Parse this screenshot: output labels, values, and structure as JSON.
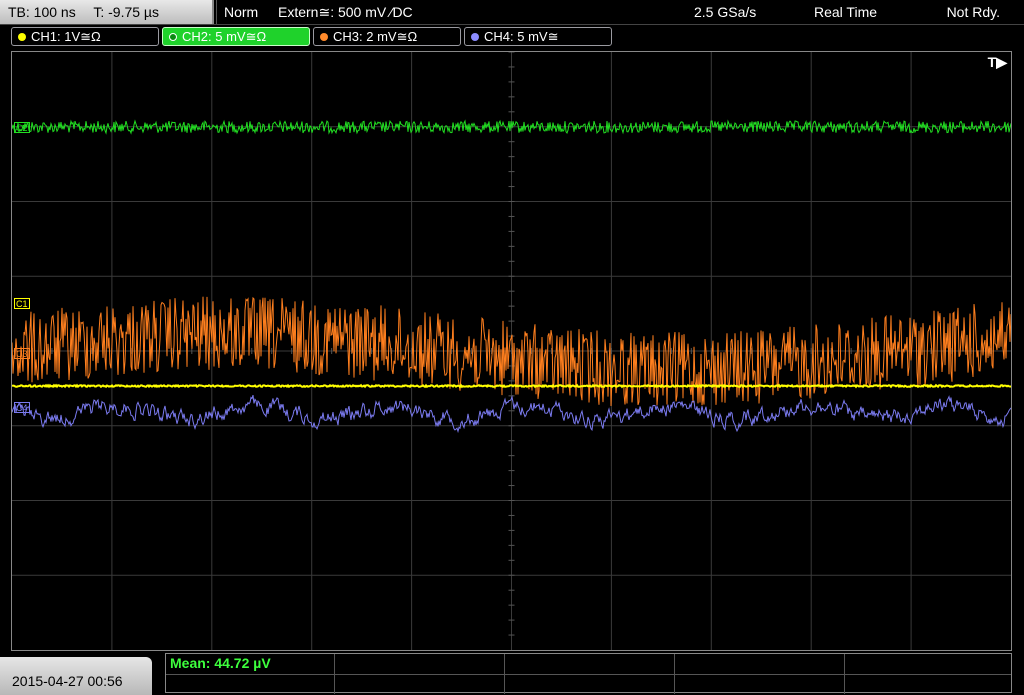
{
  "header": {
    "timebase": "TB: 100 ns",
    "trigger_offset": "T: -9.75 µs",
    "acq_mode": "Norm",
    "trigger": "Extern≅: 500 mV ⁄DC",
    "sample_rate": "2.5 GSa/s",
    "run_mode": "Real Time",
    "status": "Not Rdy."
  },
  "channels": [
    {
      "label": "CH1: 1V≅Ω",
      "color": "#ffff00",
      "active": false
    },
    {
      "label": "CH2: 5 mV≅Ω",
      "color": "#1fd22b",
      "active": true
    },
    {
      "label": "CH3: 2 mV≅Ω",
      "color": "#ff8a2b",
      "active": false
    },
    {
      "label": "CH4: 5 mV≅",
      "color": "#8c8cff",
      "active": false
    }
  ],
  "trigger_marker": "T▶",
  "trace_labels": {
    "ch2": "C2",
    "ch1": "C1",
    "ch3": "C3",
    "ch4": "C4"
  },
  "colors": {
    "ch1": "#ffff00",
    "ch2": "#22e022",
    "ch3": "#ff7f1e",
    "ch4": "#7b7bf0",
    "grid": "#3a3a3a"
  },
  "footer": {
    "datetime": "2015-04-27 00:56",
    "measurement": "Mean: 44.72 µV"
  }
}
